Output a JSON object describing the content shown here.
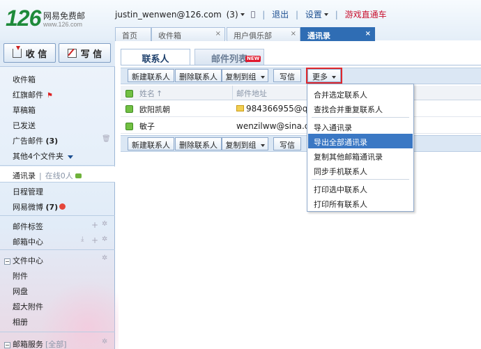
{
  "header": {
    "logo_number": "126",
    "logo_name": "网易免费邮",
    "logo_url": "www.126.com",
    "user": "justin_wenwen@126.com",
    "unread_count": "(3)",
    "logout": "退出",
    "settings": "设置",
    "game_link": "游戏直通车"
  },
  "tabs": [
    {
      "label": "首页"
    },
    {
      "label": "收件箱"
    },
    {
      "label": "用户俱乐部"
    },
    {
      "label": "通讯录"
    }
  ],
  "sidebar": {
    "receive_button": "收 信",
    "write_button": "写 信",
    "folders": [
      {
        "label": "收件箱"
      },
      {
        "label": "红旗邮件"
      },
      {
        "label": "草稿箱"
      },
      {
        "label": "已发送"
      },
      {
        "label": "广告邮件",
        "count": "(3)"
      },
      {
        "label": "其他4个文件夹"
      }
    ],
    "contacts": "通讯录",
    "online": "在线0人",
    "calendar": "日程管理",
    "weibo": "网易微博",
    "weibo_count": "(7)",
    "mail_tags": "邮件标签",
    "mailbox_center": "邮箱中心",
    "file_center": "文件中心",
    "attachments": "附件",
    "netdisk": "网盘",
    "large_attachments": "超大附件",
    "album": "相册",
    "mailbox_service": "邮箱服务",
    "service_all": "[全部]"
  },
  "content": {
    "tab_contacts": "联系人",
    "tab_maillist": "邮件列表",
    "new_badge": "NEW",
    "toolbar": {
      "new_contact": "新建联系人",
      "delete_contact": "删除联系人",
      "copy_to_group": "复制到组",
      "write": "写信",
      "more": "更多"
    },
    "columns": {
      "name": "姓名",
      "email": "邮件地址"
    },
    "rows": [
      {
        "name": "欧阳凯朝",
        "email": "984366955@qq"
      },
      {
        "name": "敏子",
        "email": "wenzilww@sina.com"
      }
    ],
    "more_menu": [
      "合并选定联系人",
      "查找合并重复联系人",
      "导入通讯录",
      "导出全部通讯录",
      "复制其他邮箱通讯录",
      "同步手机联系人",
      "打印选中联系人",
      "打印所有联系人"
    ]
  }
}
